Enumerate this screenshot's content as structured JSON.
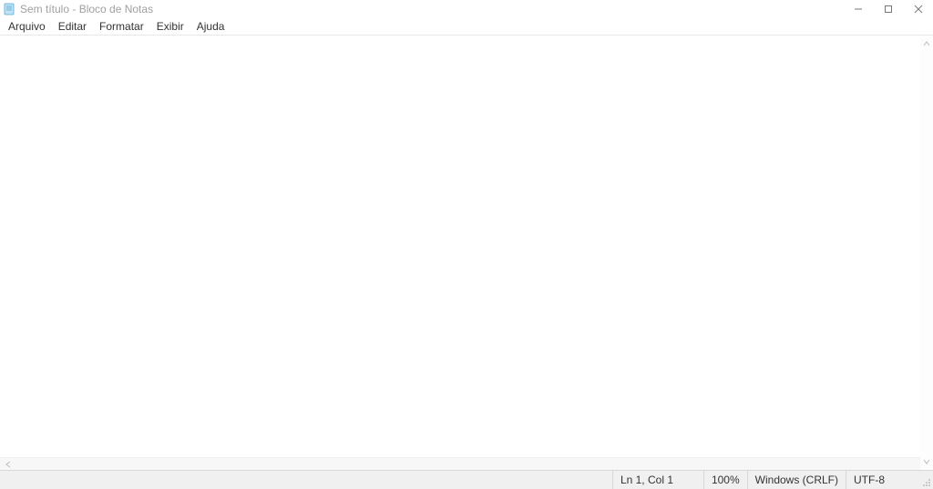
{
  "titlebar": {
    "title": "Sem título - Bloco de Notas"
  },
  "menubar": {
    "items": [
      "Arquivo",
      "Editar",
      "Formatar",
      "Exibir",
      "Ajuda"
    ]
  },
  "editor": {
    "content": ""
  },
  "statusbar": {
    "position": "Ln 1, Col 1",
    "zoom": "100%",
    "line_ending": "Windows (CRLF)",
    "encoding": "UTF-8"
  }
}
